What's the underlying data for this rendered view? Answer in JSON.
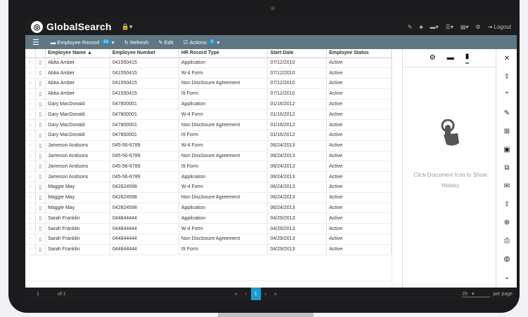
{
  "app": {
    "name": "GlobalSearch",
    "logo_icon": "globe-icon",
    "lock": "🔒▾",
    "logout": "Logout"
  },
  "top_icons": [
    "✎",
    "♣",
    "▬▾",
    "☰▾",
    "▤▾",
    "⚙"
  ],
  "toolbar": {
    "record": "Employee Record",
    "record_count": "19",
    "refresh": "Refresh",
    "edit": "Edit",
    "actions": "Actions",
    "actions_count": "0"
  },
  "columns": [
    "Employee Name ▲",
    "Employee Number",
    "HR Record Type",
    "Start Date",
    "Employee Status"
  ],
  "rows": [
    [
      "Abita Amber",
      "041550415",
      "Application",
      "07/12/2010",
      "Active"
    ],
    [
      "Abita Amber",
      "041550415",
      "W-4 Form",
      "07/12/2010",
      "Active"
    ],
    [
      "Abita Amber",
      "041550415",
      "Non Disclosure Agreement",
      "07/12/2010",
      "Active"
    ],
    [
      "Abita Amber",
      "041550415",
      "I9 Form",
      "07/12/2010",
      "Active"
    ],
    [
      "Gary MacDonald",
      "047800001",
      "Application",
      "01/16/2012",
      "Active"
    ],
    [
      "Gary MacDonald",
      "047800001",
      "W-4 Form",
      "01/16/2012",
      "Active"
    ],
    [
      "Gary MacDonald",
      "047800001",
      "Non Disclosure Agreement",
      "01/16/2012",
      "Active"
    ],
    [
      "Gary MacDonald",
      "047800001",
      "I9 Form",
      "01/16/2012",
      "Active"
    ],
    [
      "Jameson Andsons",
      "045-56-6789",
      "W-4 Form",
      "06/24/2013",
      "Active"
    ],
    [
      "Jameson Andsons",
      "045-56-6789",
      "Non Disclosure Agreement",
      "06/24/2013",
      "Active"
    ],
    [
      "Jameson Andsons",
      "045-56-6789",
      "I9 Form",
      "06/24/2013",
      "Active"
    ],
    [
      "Jameson Andsons",
      "045-56-6789",
      "Application",
      "06/24/2013",
      "Active"
    ],
    [
      "Maggie May",
      "042824598",
      "W-4 Form",
      "06/24/2013",
      "Active"
    ],
    [
      "Maggie May",
      "042824598",
      "Non Disclosure Agreement",
      "06/24/2013",
      "Active"
    ],
    [
      "Maggie May",
      "042824598",
      "Application",
      "06/24/2013",
      "Active"
    ],
    [
      "Sarah Franklin",
      "044844444",
      "Application",
      "04/29/2013",
      "Active"
    ],
    [
      "Sarah Franklin",
      "044844444",
      "W-4 Form",
      "04/29/2013",
      "Active"
    ],
    [
      "Sarah Franklin",
      "044844444",
      "Non Disclosure Agreement",
      "04/29/2013",
      "Active"
    ],
    [
      "Sarah Franklin",
      "044844444",
      "I9 Form",
      "04/29/2013",
      "Active"
    ]
  ],
  "panel": {
    "tabs": [
      "⚙",
      "▬",
      "▮"
    ],
    "message": "Click Document Icon to Show History"
  },
  "right_icons": [
    "✕",
    "⇪",
    "⌃",
    "✎",
    "⊞",
    "▣",
    "⧉",
    "✉",
    "⇪",
    "⊕",
    "⎙",
    "◍",
    "⌄"
  ],
  "footer": {
    "page_input": "1",
    "of": "of 1",
    "pages": [
      "«",
      "‹",
      "1",
      "›",
      "»"
    ],
    "per_page_value": "25",
    "per_page": "per page"
  }
}
